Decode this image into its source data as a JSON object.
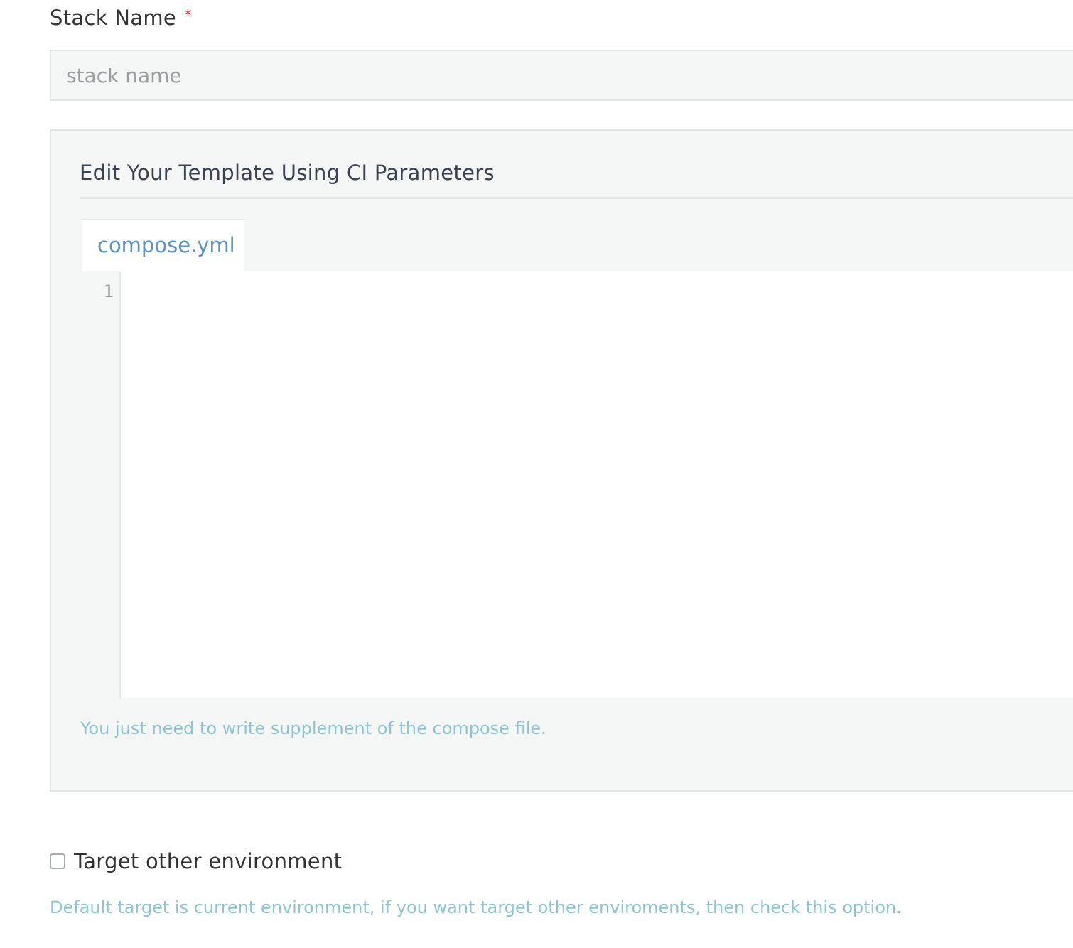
{
  "stack_name": {
    "label": "Stack Name",
    "required_marker": "*",
    "value": "",
    "placeholder": "stack name"
  },
  "template": {
    "title": "Edit Your Template Using CI Parameters",
    "tab_label": "compose.yml",
    "line_numbers": [
      "1"
    ],
    "content": "",
    "help_text": "You just need to write supplement of the compose file."
  },
  "target_env": {
    "checkbox_label": "Target other environment",
    "checked": false,
    "help_text": "Default target is current environment, if you want target other enviroments, then check this option."
  },
  "colors": {
    "accent_link": "#5b93c6",
    "help_text": "#8ec4cf",
    "required": "#c0504d",
    "panel_bg": "#f4f5f5"
  }
}
